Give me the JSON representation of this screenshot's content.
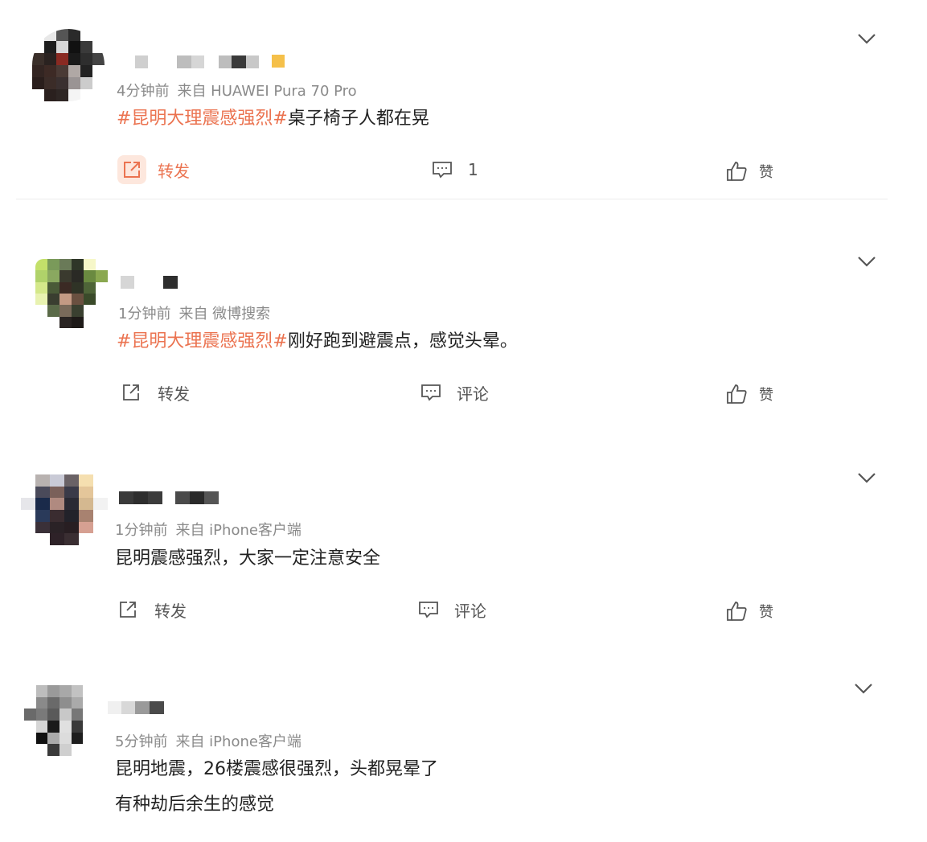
{
  "posts": [
    {
      "time": "4分钟前",
      "source": "来自 HUAWEI Pura 70 Pro",
      "topic": "#昆明大理震感强烈#",
      "text": "桌子椅子人都在晃",
      "actions": {
        "forward_label": "转发",
        "comment_label": "1",
        "like_label": "赞"
      }
    },
    {
      "time": "1分钟前",
      "source": "来自 微博搜索",
      "topic": "#昆明大理震感强烈#",
      "text": "刚好跑到避震点，感觉头晕。",
      "actions": {
        "forward_label": "转发",
        "comment_label": "评论",
        "like_label": "赞"
      }
    },
    {
      "time": "1分钟前",
      "source": "来自 iPhone客户端",
      "topic": "",
      "text": "昆明震感强烈，大家一定注意安全",
      "actions": {
        "forward_label": "转发",
        "comment_label": "评论",
        "like_label": "赞"
      }
    },
    {
      "time": "5分钟前",
      "source": "来自 iPhone客户端",
      "topic": "",
      "text": "昆明地震，26楼震感很强烈，头都晃晕了",
      "text2": "有种劫后余生的感觉"
    }
  ],
  "colors": {
    "topic": "#eb7350",
    "meta": "#8a8a8a",
    "divider": "#ececec"
  },
  "icons": [
    "forward-icon",
    "comment-icon",
    "like-icon",
    "chevron-down-icon"
  ]
}
